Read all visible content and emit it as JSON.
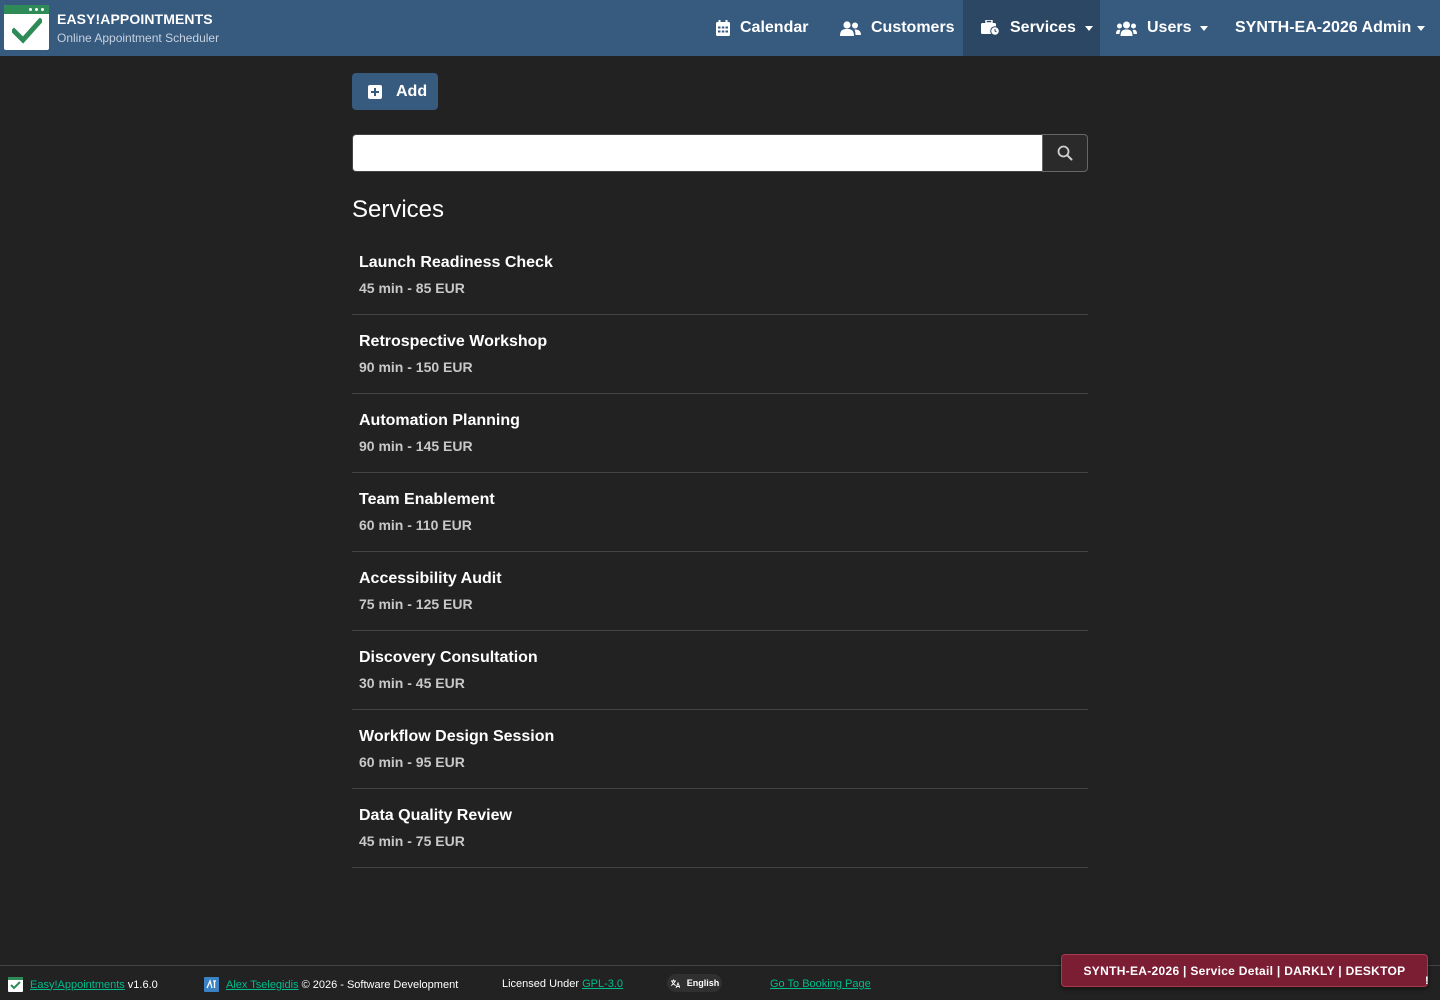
{
  "app": {
    "title": "EASY!APPOINTMENTS",
    "subtitle": "Online Appointment Scheduler"
  },
  "nav": {
    "calendar": "Calendar",
    "customers": "Customers",
    "services": "Services",
    "users": "Users",
    "account": "SYNTH-EA-2026 Admin"
  },
  "toolbar": {
    "add_label": "Add"
  },
  "search": {
    "value": "",
    "placeholder": ""
  },
  "main": {
    "title": "Services",
    "services": [
      {
        "name": "Launch Readiness Check",
        "meta": "45 min - 85 EUR"
      },
      {
        "name": "Retrospective Workshop",
        "meta": "90 min - 150 EUR"
      },
      {
        "name": "Automation Planning",
        "meta": "90 min - 145 EUR"
      },
      {
        "name": "Team Enablement",
        "meta": "60 min - 110 EUR"
      },
      {
        "name": "Accessibility Audit",
        "meta": "75 min - 125 EUR"
      },
      {
        "name": "Discovery Consultation",
        "meta": "30 min - 45 EUR"
      },
      {
        "name": "Workflow Design Session",
        "meta": "60 min - 95 EUR"
      },
      {
        "name": "Data Quality Review",
        "meta": "45 min - 75 EUR"
      }
    ]
  },
  "footer": {
    "app_link": "Easy!Appointments",
    "version": "v1.6.0",
    "author_link": "Alex Tselegidis",
    "copyright": "© 2026 - Software Development",
    "license_prefix": "Licensed Under",
    "license_link": "GPL-3.0",
    "language": "English",
    "booking_link": "Go To Booking Page",
    "edge_text": "!"
  },
  "badge": {
    "text": "SYNTH-EA-2026 | Service Detail | DARKLY | DESKTOP"
  },
  "colors": {
    "header": "#375a7f",
    "background": "#222222",
    "accent_link": "#00bc8c",
    "badge": "#7b1d33"
  }
}
